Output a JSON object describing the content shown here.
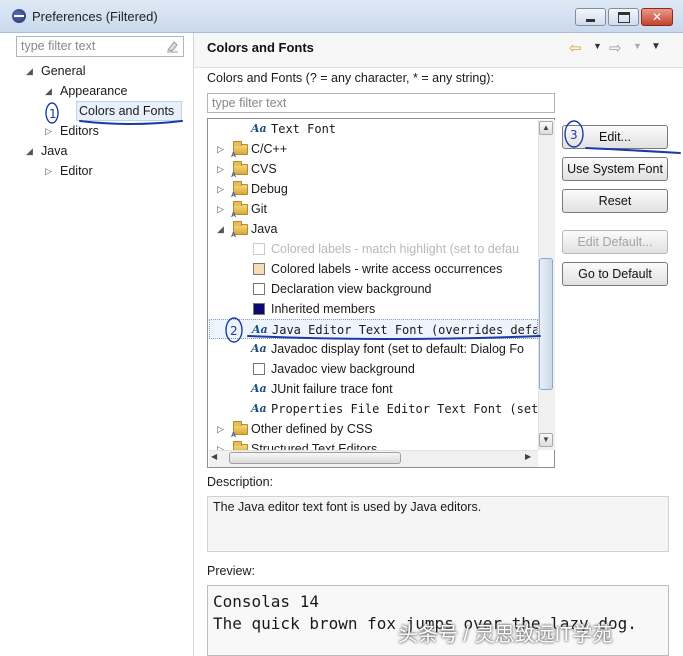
{
  "window": {
    "title": "Preferences (Filtered)"
  },
  "left": {
    "filter_placeholder": "type filter text",
    "tree": [
      {
        "label": "General",
        "twisty": "◢"
      },
      {
        "label": "Appearance",
        "twisty": "◢"
      },
      {
        "label": "Colors and Fonts",
        "twisty": ""
      },
      {
        "label": "Editors",
        "twisty": "▷"
      },
      {
        "label": "Java",
        "twisty": "◢"
      },
      {
        "label": "Editor",
        "twisty": "▷"
      }
    ]
  },
  "page": {
    "title": "Colors and Fonts",
    "intro": "Colors and Fonts (? = any character, * = any string):",
    "filter_placeholder": "type filter text",
    "list": [
      {
        "label": "Text Font",
        "icon": "font",
        "indent": 2,
        "mono": true
      },
      {
        "label": "C/C++",
        "icon": "folder",
        "twisty": "▷"
      },
      {
        "label": "CVS",
        "icon": "folder",
        "twisty": "▷"
      },
      {
        "label": "Debug",
        "icon": "folder",
        "twisty": "▷"
      },
      {
        "label": "Git",
        "icon": "folder",
        "twisty": "▷"
      },
      {
        "label": "Java",
        "icon": "folder",
        "twisty": "◢"
      },
      {
        "label": "Colored labels - match highlight (set to defau",
        "icon": "swatch",
        "color": "#ffffff",
        "disabled": true
      },
      {
        "label": "Colored labels - write access occurrences",
        "icon": "swatch",
        "color": "#f5deb3"
      },
      {
        "label": "Declaration view background",
        "icon": "swatch",
        "color": "#ffffff"
      },
      {
        "label": "Inherited members",
        "icon": "swatch",
        "color": "#0a0a6e"
      },
      {
        "label": "Java Editor Text Font (overrides defau",
        "icon": "font",
        "mono": true,
        "selected": true
      },
      {
        "label": "Javadoc display font (set to default: Dialog Fo",
        "icon": "font"
      },
      {
        "label": "Javadoc view background",
        "icon": "swatch",
        "color": "#ffffff"
      },
      {
        "label": "JUnit failure trace font",
        "icon": "font"
      },
      {
        "label": "Properties File Editor Text Font (set",
        "icon": "font",
        "mono": true
      },
      {
        "label": "Other defined by CSS",
        "icon": "folder",
        "twisty": "▷"
      },
      {
        "label": "Structured Text Editors",
        "icon": "folder",
        "twisty": "▷"
      }
    ],
    "buttons": {
      "edit": "Edit...",
      "use_system_font": "Use System Font",
      "reset": "Reset",
      "edit_default": "Edit Default...",
      "go_to_default": "Go to Default"
    },
    "description_label": "Description:",
    "description_text": "The Java editor text font is used by Java editors.",
    "preview_label": "Preview:",
    "preview_lines": [
      "Consolas 14",
      "The quick brown fox jumps over the lazy dog."
    ]
  },
  "watermark": "头条号 / 灵思致远IT学苑",
  "annotations": [
    "1",
    "2",
    "3"
  ],
  "colors": {
    "annotation_ink": "#1e3aa8",
    "selection": "#e8f0fa",
    "titlebar": "#c9d9ec"
  }
}
